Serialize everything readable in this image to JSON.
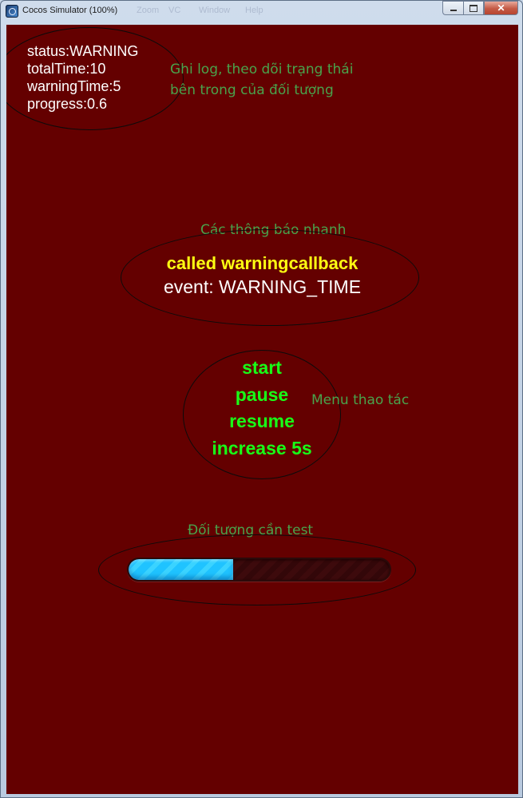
{
  "window": {
    "title": "Cocos Simulator (100%)",
    "menu_ghost": [
      "Zoom",
      "VC",
      "Window",
      "Help"
    ],
    "controls": {
      "minimize": "",
      "maximize": "",
      "close": "✕"
    }
  },
  "log": {
    "lines": [
      "status:WARNING",
      "totalTime:10",
      "warningTime:5",
      "progress:0.6"
    ],
    "note_line1": "Ghi log, theo dõi trạng thái",
    "note_line2": "bên trong của đối tượng"
  },
  "notifications": {
    "note": "Các thông báo nhanh",
    "called_text": "called warningcallback",
    "event_text": "event: WARNING_TIME"
  },
  "menu": {
    "note": "Menu thao tác",
    "items": [
      "start",
      "pause",
      "resume",
      "increase 5s"
    ]
  },
  "test_object": {
    "note": "Đối tượng cần test",
    "progress": 0.4
  },
  "colors": {
    "canvas_bg": "#640000",
    "menu_text": "#18ff18",
    "callback_text": "#ffff12",
    "note_text": "#49a34c",
    "progress_fill": "#1fc3ff"
  }
}
